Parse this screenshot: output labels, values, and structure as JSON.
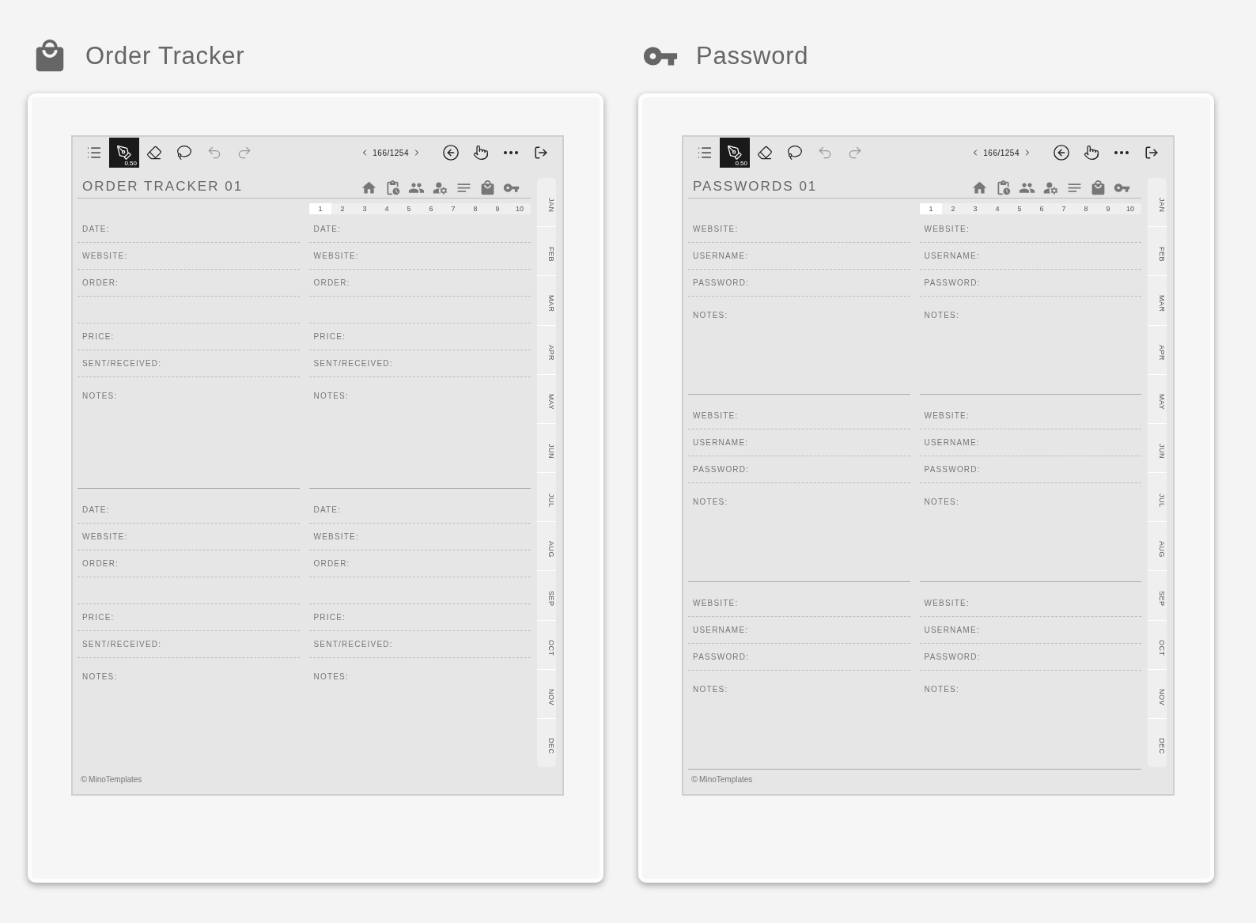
{
  "panels": [
    {
      "heading": {
        "text": "Order Tracker",
        "kind": "bag"
      },
      "toolbar": {
        "tools": [
          {
            "kind": "menu",
            "selected": false
          },
          {
            "kind": "pen",
            "selected": true
          },
          {
            "kind": "eraser",
            "selected": false
          },
          {
            "kind": "lasso",
            "selected": false
          },
          {
            "kind": "undo",
            "selected": false
          },
          {
            "kind": "redo",
            "selected": false
          }
        ],
        "pen_size": "0.50",
        "page_counter": "166/1254"
      },
      "page_title": "ORDER TRACKER 01",
      "page_tabs": [
        {
          "label": "1",
          "selected": true
        },
        {
          "label": "2",
          "selected": false
        },
        {
          "label": "3",
          "selected": false
        },
        {
          "label": "4",
          "selected": false
        },
        {
          "label": "5",
          "selected": false
        },
        {
          "label": "6",
          "selected": false
        },
        {
          "label": "7",
          "selected": false
        },
        {
          "label": "8",
          "selected": false
        },
        {
          "label": "9",
          "selected": false
        },
        {
          "label": "10",
          "selected": false
        }
      ],
      "blocks": [
        {
          "columns": [
            {
              "fields": [
                {
                  "kind": "line",
                  "label": "DATE:"
                },
                {
                  "kind": "line",
                  "label": "WEBSITE:"
                },
                {
                  "kind": "line",
                  "label": "ORDER:"
                },
                {
                  "kind": "blank"
                },
                {
                  "kind": "line",
                  "label": "PRICE:"
                },
                {
                  "kind": "line",
                  "label": "SENT/RECEIVED:"
                },
                {
                  "kind": "notes",
                  "label": "NOTES:"
                }
              ]
            },
            {
              "fields": [
                {
                  "kind": "line",
                  "label": "DATE:"
                },
                {
                  "kind": "line",
                  "label": "WEBSITE:"
                },
                {
                  "kind": "line",
                  "label": "ORDER:"
                },
                {
                  "kind": "blank"
                },
                {
                  "kind": "line",
                  "label": "PRICE:"
                },
                {
                  "kind": "line",
                  "label": "SENT/RECEIVED:"
                },
                {
                  "kind": "notes",
                  "label": "NOTES:"
                }
              ]
            }
          ]
        },
        {
          "columns": [
            {
              "fields": [
                {
                  "kind": "line",
                  "label": "DATE:"
                },
                {
                  "kind": "line",
                  "label": "WEBSITE:"
                },
                {
                  "kind": "line",
                  "label": "ORDER:"
                },
                {
                  "kind": "blank"
                },
                {
                  "kind": "line",
                  "label": "PRICE:"
                },
                {
                  "kind": "line",
                  "label": "SENT/RECEIVED:"
                },
                {
                  "kind": "notes",
                  "label": "NOTES:"
                }
              ]
            },
            {
              "fields": [
                {
                  "kind": "line",
                  "label": "DATE:"
                },
                {
                  "kind": "line",
                  "label": "WEBSITE:"
                },
                {
                  "kind": "line",
                  "label": "ORDER:"
                },
                {
                  "kind": "blank"
                },
                {
                  "kind": "line",
                  "label": "PRICE:"
                },
                {
                  "kind": "line",
                  "label": "SENT/RECEIVED:"
                },
                {
                  "kind": "notes",
                  "label": "NOTES:"
                }
              ]
            }
          ]
        }
      ],
      "footer_rule": false,
      "months": [
        "JAN",
        "FEB",
        "MAR",
        "APR",
        "MAY",
        "JUN",
        "JUL",
        "AUG",
        "SEP",
        "OCT",
        "NOV",
        "DEC"
      ],
      "footer": {
        "mark": "©",
        "text": "MinoTemplates"
      }
    },
    {
      "heading": {
        "text": "Password",
        "kind": "key"
      },
      "toolbar": {
        "tools": [
          {
            "kind": "menu",
            "selected": false
          },
          {
            "kind": "pen",
            "selected": true
          },
          {
            "kind": "eraser",
            "selected": false
          },
          {
            "kind": "lasso",
            "selected": false
          },
          {
            "kind": "undo",
            "selected": false
          },
          {
            "kind": "redo",
            "selected": false
          }
        ],
        "pen_size": "0.50",
        "page_counter": "166/1254"
      },
      "page_title": "PASSWORDS 01",
      "page_tabs": [
        {
          "label": "1",
          "selected": true
        },
        {
          "label": "2",
          "selected": false
        },
        {
          "label": "3",
          "selected": false
        },
        {
          "label": "4",
          "selected": false
        },
        {
          "label": "5",
          "selected": false
        },
        {
          "label": "6",
          "selected": false
        },
        {
          "label": "7",
          "selected": false
        },
        {
          "label": "8",
          "selected": false
        },
        {
          "label": "9",
          "selected": false
        },
        {
          "label": "10",
          "selected": false
        }
      ],
      "blocks": [
        {
          "columns": [
            {
              "fields": [
                {
                  "kind": "line",
                  "label": "WEBSITE:"
                },
                {
                  "kind": "line",
                  "label": "USERNAME:"
                },
                {
                  "kind": "line",
                  "label": "PASSWORD:"
                },
                {
                  "kind": "notes",
                  "label": "NOTES:"
                }
              ]
            },
            {
              "fields": [
                {
                  "kind": "line",
                  "label": "WEBSITE:"
                },
                {
                  "kind": "line",
                  "label": "USERNAME:"
                },
                {
                  "kind": "line",
                  "label": "PASSWORD:"
                },
                {
                  "kind": "notes",
                  "label": "NOTES:"
                }
              ]
            }
          ]
        },
        {
          "columns": [
            {
              "fields": [
                {
                  "kind": "line",
                  "label": "WEBSITE:"
                },
                {
                  "kind": "line",
                  "label": "USERNAME:"
                },
                {
                  "kind": "line",
                  "label": "PASSWORD:"
                },
                {
                  "kind": "notes",
                  "label": "NOTES:"
                }
              ]
            },
            {
              "fields": [
                {
                  "kind": "line",
                  "label": "WEBSITE:"
                },
                {
                  "kind": "line",
                  "label": "USERNAME:"
                },
                {
                  "kind": "line",
                  "label": "PASSWORD:"
                },
                {
                  "kind": "notes",
                  "label": "NOTES:"
                }
              ]
            }
          ]
        },
        {
          "columns": [
            {
              "fields": [
                {
                  "kind": "line",
                  "label": "WEBSITE:"
                },
                {
                  "kind": "line",
                  "label": "USERNAME:"
                },
                {
                  "kind": "line",
                  "label": "PASSWORD:"
                },
                {
                  "kind": "notes",
                  "label": "NOTES:"
                }
              ]
            },
            {
              "fields": [
                {
                  "kind": "line",
                  "label": "WEBSITE:"
                },
                {
                  "kind": "line",
                  "label": "USERNAME:"
                },
                {
                  "kind": "line",
                  "label": "PASSWORD:"
                },
                {
                  "kind": "notes",
                  "label": "NOTES:"
                }
              ]
            }
          ]
        }
      ],
      "footer_rule": true,
      "months": [
        "JAN",
        "FEB",
        "MAR",
        "APR",
        "MAY",
        "JUN",
        "JUL",
        "AUG",
        "SEP",
        "OCT",
        "NOV",
        "DEC"
      ],
      "footer": {
        "mark": "©",
        "text": "MinoTemplates"
      }
    }
  ]
}
